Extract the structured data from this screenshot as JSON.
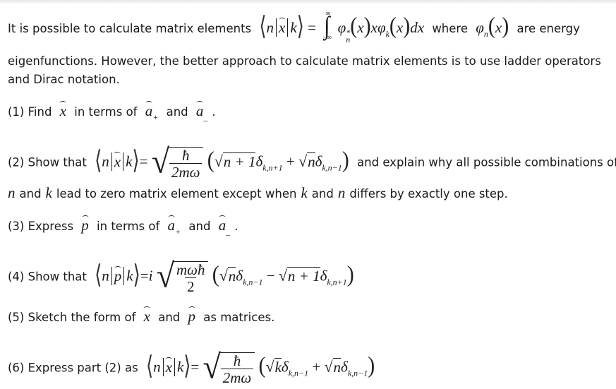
{
  "intro": {
    "line1_text": "It is possible to calculate matrix elements",
    "line1_where": "where",
    "line1_tail": "are energy",
    "line2": "eigenfunctions. However, the better approach to calculate matrix elements is to use ladder operators",
    "line3": "and Dirac notation."
  },
  "math": {
    "n": "n",
    "k": "k",
    "x": "x",
    "p": "p",
    "a": "a",
    "eq": "=",
    "plus": "+",
    "minus": "−",
    "hbar": "ħ",
    "two_m_omega": "2mω",
    "m_omega_hbar": "mωħ",
    "two": "2",
    "i": "i",
    "phi": "φ",
    "delta": "δ",
    "star": "*",
    "dx": "dx",
    "lparen": "(",
    "rparen": ")",
    "inf": "∞",
    "neg_inf": "−∞",
    "int": "∫",
    "langle": "⟨",
    "rangle": "⟩",
    "sqrt": "√",
    "sub_plus": "+",
    "sub_minus": "_",
    "n_plus_1": "n + 1",
    "sub_kn_plus1": "k,n+1",
    "sub_kn_minus1": "k,n−1"
  },
  "problems": [
    {
      "label": "(1) Find",
      "mid": "in terms of",
      "and": "and",
      "end": "."
    },
    {
      "label": "(2) Show that",
      "tail": "and explain why all possible combinations of",
      "line2_and": "and",
      "line2_mid": "lead to zero matrix element except when",
      "line2_and2": "and",
      "line2_end": "differs by exactly one step."
    },
    {
      "label": "(3) Express",
      "mid": "in terms of",
      "and": "and",
      "end": "."
    },
    {
      "label": "(4) Show that"
    },
    {
      "label": "(5) Sketch the form of",
      "and": "and",
      "end": "as matrices."
    },
    {
      "label": "(6) Express part (2) as"
    }
  ]
}
